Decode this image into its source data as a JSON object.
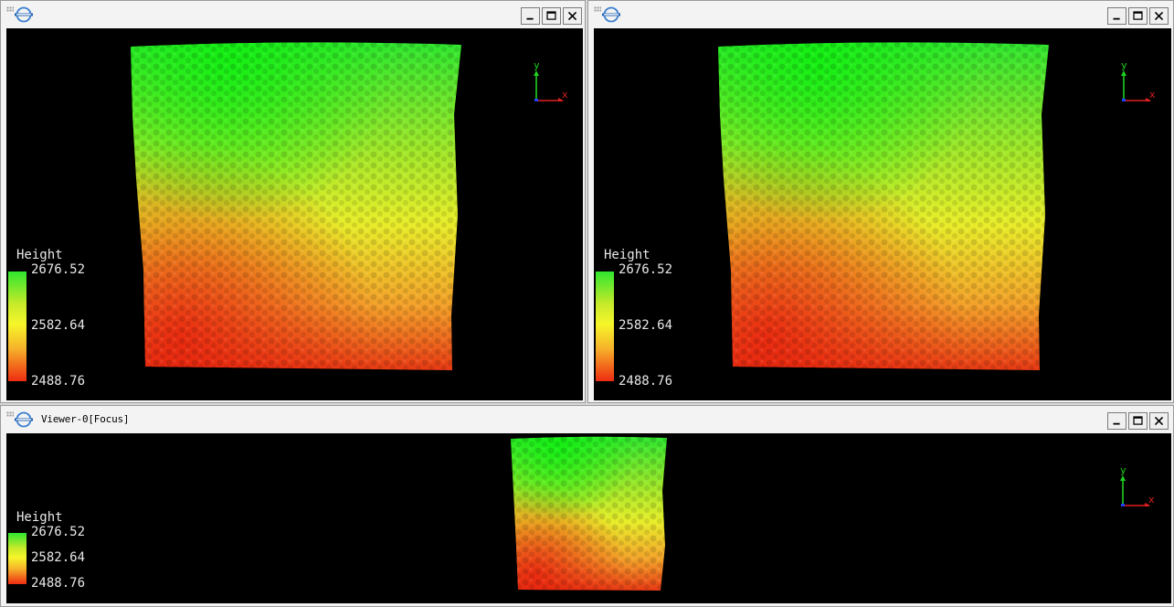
{
  "viewers": [
    {
      "title": ""
    },
    {
      "title": ""
    },
    {
      "title": "Viewer-0[Focus]"
    }
  ],
  "legend": {
    "title": "Height",
    "max": "2676.52",
    "mid": "2582.64",
    "min": "2488.76"
  },
  "axes": {
    "x_label": "x",
    "y_label": "y"
  },
  "colors": {
    "high": "#2fe62f",
    "mid": "#f6f62a",
    "low": "#ee2c12",
    "axis_x": "#e02020",
    "axis_y": "#20d020",
    "axis_z": "#2040ff"
  }
}
